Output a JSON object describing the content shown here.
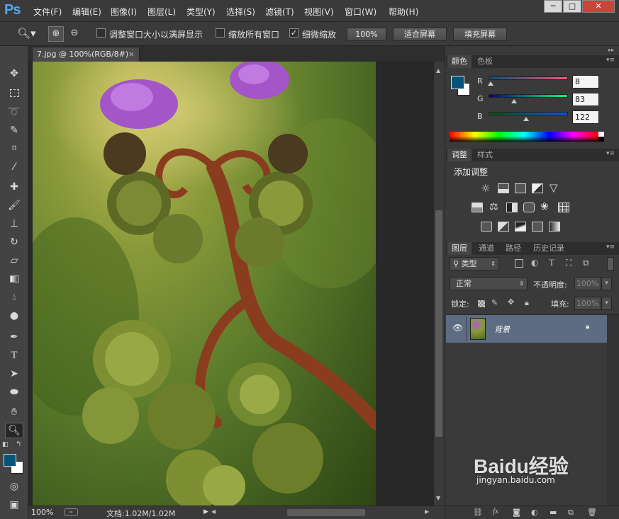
{
  "app": {
    "logo": "Ps"
  },
  "menu": [
    "文件(F)",
    "编辑(E)",
    "图像(I)",
    "图层(L)",
    "类型(Y)",
    "选择(S)",
    "滤镜(T)",
    "视图(V)",
    "窗口(W)",
    "帮助(H)"
  ],
  "window_controls": {
    "minimize": "─",
    "maximize": "□",
    "close": "✕"
  },
  "options": {
    "resize_windows_label": "调整窗口大小以满屏显示",
    "resize_windows_checked": false,
    "zoom_all_label": "缩放所有窗口",
    "zoom_all_checked": false,
    "scrubby_zoom_label": "细微缩放",
    "scrubby_zoom_checked": true,
    "zoom_100_label": "100%",
    "fit_screen_label": "适合屏幕",
    "fill_screen_label": "填充屏幕"
  },
  "document": {
    "tab_title": "7.jpg @ 100%(RGB/8#)",
    "close": "×"
  },
  "status": {
    "zoom": "100%",
    "doc_info": "文档:1.02M/1.02M"
  },
  "color_panel": {
    "tabs": [
      "颜色",
      "色板"
    ],
    "r_label": "R",
    "r_value": "8",
    "g_label": "G",
    "g_value": "83",
    "b_label": "B",
    "b_value": "122",
    "foreground": "#085379",
    "background": "#ffffff"
  },
  "adjust_panel": {
    "tabs": [
      "调整",
      "样式"
    ],
    "title": "添加调整"
  },
  "layers_panel": {
    "tabs": [
      "图层",
      "通道",
      "路径",
      "历史记录"
    ],
    "filter_label": "类型",
    "blend_mode": "正常",
    "opacity_label": "不透明度:",
    "opacity_value": "100%",
    "lock_label": "锁定:",
    "fill_label": "填充:",
    "fill_value": "100%",
    "layer_name": "背景"
  },
  "watermark": {
    "brand": "Baidu经验",
    "url": "jingyan.baidu.com"
  },
  "colors": {
    "accent": "#5aa6ee",
    "selected_layer": "#5d6c82"
  }
}
